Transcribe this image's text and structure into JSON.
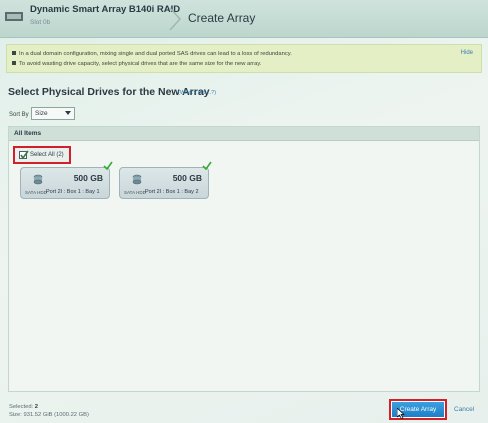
{
  "header": {
    "controller_name": "Dynamic Smart Array B140i RAID",
    "controller_slot": "Slot 0b",
    "page_title": "Create Array"
  },
  "banner": {
    "line1": "In a dual domain configuration, mixing single and dual ported SAS drives can lead to a loss of redundancy.",
    "line2": "To avoid wasting drive capacity, select physical drives that are the same size for the new array.",
    "hide_label": "Hide"
  },
  "section": {
    "title": "Select Physical Drives for the New Array",
    "whats_this": "(What's this...?)"
  },
  "sort": {
    "label": "Sort By",
    "selected": "Size"
  },
  "panel": {
    "heading": "All Items",
    "select_all_label": "Select All (2)"
  },
  "drives": [
    {
      "capacity": "500 GB",
      "type": "SATA HDD",
      "location": "Port 2I : Box 1 : Bay 1"
    },
    {
      "capacity": "500 GB",
      "type": "SATA HDD",
      "location": "Port 2I : Box 1 : Bay 2"
    }
  ],
  "status": {
    "selected_label": "Selected:",
    "selected_value": "2",
    "size_label": "Size:",
    "size_value": "931.52 GiB (1000.22 GB)"
  },
  "actions": {
    "create_label": "Create Array",
    "cancel_label": "Cancel"
  },
  "colors": {
    "accent": "#1e7fc6",
    "highlight": "#d0202a",
    "banner": "#e4efc6"
  }
}
